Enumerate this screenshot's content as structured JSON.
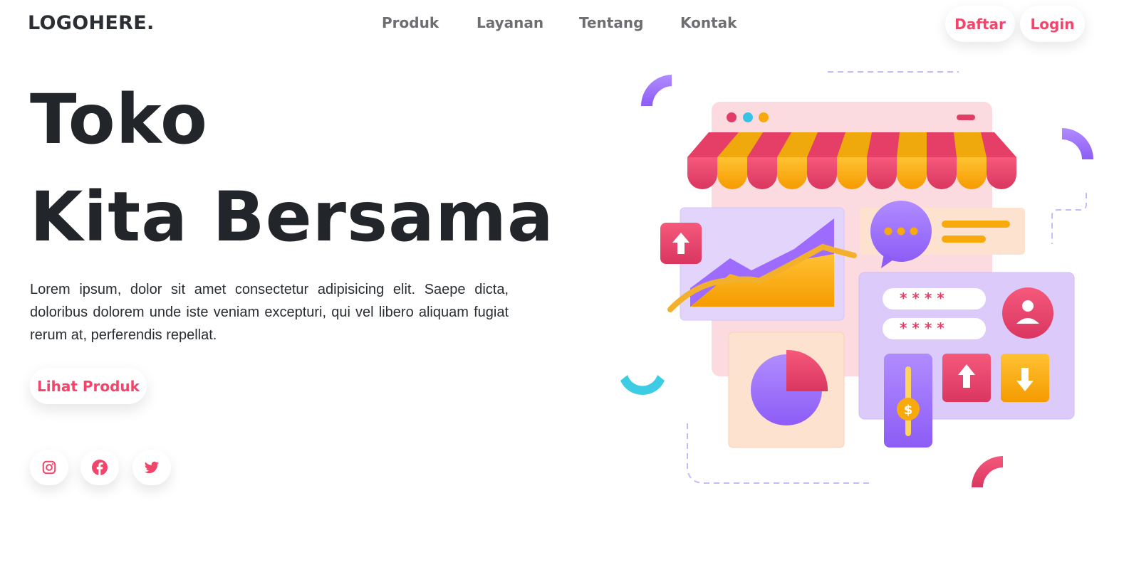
{
  "brand": {
    "logo_text": "LOGOHERE."
  },
  "nav": {
    "items": [
      {
        "label": "Produk"
      },
      {
        "label": "Layanan"
      },
      {
        "label": "Tentang"
      },
      {
        "label": "Kontak"
      }
    ]
  },
  "auth": {
    "register_label": "Daftar",
    "login_label": "Login"
  },
  "hero": {
    "title_line1": "Toko",
    "title_line2": "Kita Bersama",
    "description": "Lorem ipsum, dolor sit amet consectetur adipisicing elit. Saepe dicta, doloribus dolorem unde iste veniam excepturi, qui vel libero aliquam fugiat rerum at, perferendis repellat.",
    "cta_label": "Lihat Produk"
  },
  "social": [
    {
      "icon": "instagram-icon"
    },
    {
      "icon": "facebook-icon"
    },
    {
      "icon": "twitter-icon"
    }
  ],
  "illustration": {
    "password_mask": "* * * *",
    "price_symbol": "$"
  },
  "colors": {
    "accent": "#f2456b",
    "text_dark": "#22262b",
    "nav_text": "#6e6e72",
    "purple": "#9a6bff",
    "orange": "#f8a90c",
    "pink_light": "#fcdbe0",
    "cyan": "#3ccde5"
  }
}
